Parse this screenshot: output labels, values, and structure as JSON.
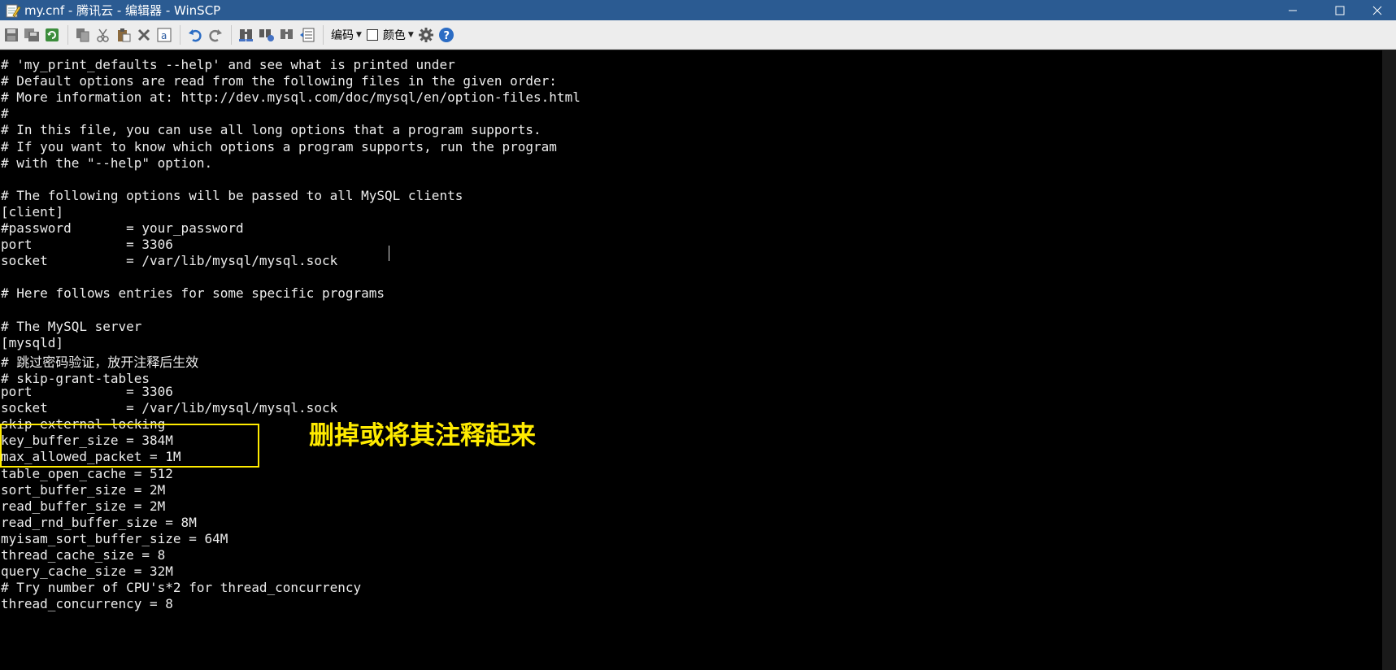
{
  "window": {
    "title": "my.cnf - 腾讯云 - 编辑器 - WinSCP",
    "icons": [
      "notepad-icon",
      "minimize-icon",
      "maximize-icon",
      "close-icon"
    ]
  },
  "toolbar": {
    "buttons": [
      "save-icon",
      "save-all-icon",
      "reload-icon",
      "copy-icon",
      "cut-icon",
      "paste-icon",
      "delete-icon",
      "select-all-icon",
      "undo-icon",
      "redo-icon",
      "find-icon",
      "replace-icon",
      "find-next-icon",
      "goto-line-icon",
      "settings-icon",
      "help-icon"
    ],
    "encoding_label": "编码",
    "color_label": "颜色"
  },
  "editor": {
    "lines": [
      "# 'my_print_defaults --help' and see what is printed under",
      "# Default options are read from the following files in the given order:",
      "# More information at: http://dev.mysql.com/doc/mysql/en/option-files.html",
      "#",
      "# In this file, you can use all long options that a program supports.",
      "# If you want to know which options a program supports, run the program",
      "# with the \"--help\" option.",
      "",
      "# The following options will be passed to all MySQL clients",
      "[client]",
      "#password       = your_password",
      "port            = 3306",
      "socket          = /var/lib/mysql/mysql.sock",
      "",
      "# Here follows entries for some specific programs",
      "",
      "# The MySQL server",
      "[mysqld]",
      "# 跳过密码验证，放开注释后生效",
      "# skip-grant-tables",
      "port            = 3306",
      "socket          = /var/lib/mysql/mysql.sock",
      "skip-external-locking",
      "key_buffer_size = 384M",
      "max_allowed_packet = 1M",
      "table_open_cache = 512",
      "sort_buffer_size = 2M",
      "read_buffer_size = 2M",
      "read_rnd_buffer_size = 8M",
      "myisam_sort_buffer_size = 64M",
      "thread_cache_size = 8",
      "query_cache_size = 32M",
      "# Try number of CPU's*2 for thread_concurrency",
      "thread_concurrency = 8"
    ]
  },
  "annotation": {
    "text": "删掉或将其注释起来",
    "color": "#ffeb00"
  },
  "colors": {
    "titlebar": "#2b5b92",
    "toolbar": "#ededed",
    "editor_bg": "#000000",
    "editor_text": "#ececec"
  }
}
